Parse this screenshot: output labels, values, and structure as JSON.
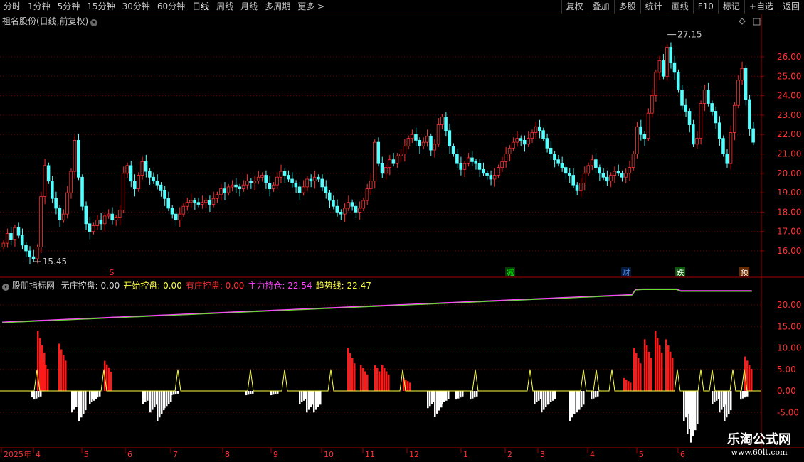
{
  "toolbar": {
    "periods": [
      "分时",
      "1分钟",
      "5分钟",
      "15分钟",
      "30分钟",
      "60分钟",
      "日线",
      "周线",
      "月线",
      "多周期",
      "更多 >"
    ],
    "active_period": "日线",
    "right_buttons": [
      "复权",
      "叠加",
      "多股",
      "统计",
      "画线",
      "F10",
      "标记",
      "+自选",
      "返回"
    ]
  },
  "main_chart": {
    "title": "祖名股份(日线,前复权)",
    "high_label": "27.15",
    "low_label": "15.45",
    "price_ticks": [
      "26.00",
      "25.00",
      "24.00",
      "23.00",
      "22.00",
      "21.00",
      "20.00",
      "19.00",
      "18.00",
      "17.00",
      "16.00"
    ],
    "event_markers": [
      {
        "text": "S",
        "color": "#ff3333",
        "bg": "none"
      },
      {
        "text": "减",
        "color": "#00ff00",
        "bg": "#0a3a0a"
      },
      {
        "text": "财",
        "color": "#5599ff",
        "bg": "#0a1a3a"
      },
      {
        "text": "跌",
        "color": "#ffffff",
        "bg": "#0a5a0a"
      },
      {
        "text": "预",
        "color": "#ffffff",
        "bg": "#6a2a00"
      }
    ]
  },
  "indicator": {
    "name": "股朋指标网",
    "fields": [
      {
        "label": "无庄控盘:",
        "value": "0.00",
        "color": "#d8d8d8"
      },
      {
        "label": "开始控盘:",
        "value": "0.00",
        "color": "#ffff44"
      },
      {
        "label": "有庄控盘:",
        "value": "0.00",
        "color": "#ff3030"
      },
      {
        "label": "主力持仓:",
        "value": "22.54",
        "color": "#ff44ff"
      },
      {
        "label": "趋势线:",
        "value": "22.47",
        "color": "#ffff44"
      }
    ],
    "ticks": [
      "20.00",
      "15.00",
      "10.00",
      "5.00",
      "0.00",
      "-5.00"
    ]
  },
  "date_axis": [
    "2025年",
    "4",
    "5",
    "6",
    "7",
    "8",
    "9",
    "10",
    "11",
    "12",
    "1",
    "2",
    "3",
    "4",
    "5",
    "6"
  ],
  "watermark": {
    "line1": "乐淘公式网",
    "line2": "www.60lt.com"
  },
  "colors": {
    "up": "#ff3232",
    "down": "#54ffff",
    "grid": "#7a0000",
    "axis": "#a00000"
  },
  "chart_data": {
    "type": "candlestick",
    "price_axis": {
      "min": 15.45,
      "max": 27.15
    },
    "closes": [
      16.4,
      16.9,
      16.6,
      17.2,
      16.8,
      16.3,
      16.0,
      15.7,
      15.6,
      16.2,
      18.8,
      20.4,
      19.6,
      18.7,
      18.2,
      17.6,
      17.9,
      19.0,
      20.1,
      21.7,
      19.8,
      18.3,
      17.4,
      17.0,
      17.3,
      17.6,
      17.4,
      17.8,
      17.9,
      17.6,
      17.7,
      18.1,
      20.0,
      20.4,
      19.6,
      19.2,
      19.9,
      20.6,
      20.1,
      19.8,
      19.6,
      19.4,
      19.1,
      18.7,
      18.2,
      17.9,
      17.6,
      17.9,
      18.3,
      18.5,
      18.6,
      18.5,
      18.4,
      18.5,
      18.6,
      18.4,
      18.7,
      18.9,
      19.2,
      19.0,
      19.3,
      19.4,
      19.3,
      19.2,
      19.4,
      19.6,
      19.5,
      19.6,
      19.8,
      19.9,
      19.5,
      19.2,
      19.4,
      19.8,
      20.1,
      19.9,
      19.7,
      19.5,
      19.3,
      19.0,
      19.3,
      19.7,
      19.6,
      19.8,
      19.7,
      19.3,
      19.0,
      18.6,
      18.3,
      18.0,
      17.9,
      18.2,
      18.5,
      18.3,
      18.0,
      18.2,
      18.6,
      19.2,
      19.6,
      21.6,
      20.5,
      20.0,
      20.3,
      20.7,
      20.5,
      20.9,
      21.0,
      21.4,
      21.8,
      22.0,
      21.7,
      21.4,
      21.6,
      21.9,
      21.2,
      21.5,
      22.5,
      22.9,
      22.2,
      21.4,
      21.0,
      20.5,
      20.2,
      20.5,
      20.8,
      20.6,
      20.5,
      20.2,
      20.0,
      19.9,
      19.7,
      19.9,
      20.3,
      20.6,
      21.0,
      21.3,
      21.6,
      21.8,
      21.7,
      21.5,
      21.8,
      22.1,
      22.4,
      22.2,
      21.8,
      21.3,
      21.0,
      20.7,
      20.5,
      20.3,
      20.0,
      19.9,
      19.4,
      19.1,
      19.5,
      20.0,
      20.4,
      20.7,
      20.3,
      20.0,
      19.8,
      19.6,
      19.9,
      20.1,
      20.0,
      19.8,
      20.0,
      20.3,
      21.0,
      22.4,
      22.0,
      21.8,
      23.1,
      24.0,
      25.2,
      25.8,
      25.0,
      26.5,
      25.7,
      25.2,
      24.3,
      23.5,
      23.2,
      22.5,
      21.5,
      21.8,
      23.6,
      24.3,
      23.6,
      23.2,
      22.6,
      21.8,
      21.0,
      20.5,
      22.1,
      23.5,
      24.8,
      25.4,
      23.8,
      22.3,
      21.6
    ]
  }
}
